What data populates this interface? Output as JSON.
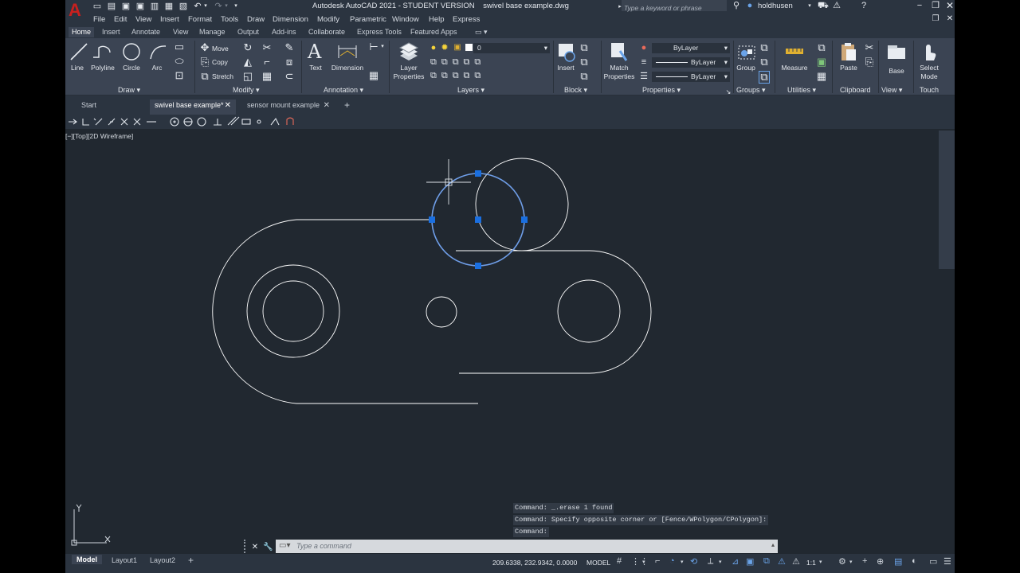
{
  "app": {
    "window_title": "Autodesk AutoCAD 2021 - STUDENT VERSION",
    "file_name": "swivel base example.dwg",
    "search_placeholder": "Type a keyword or phrase",
    "user_name": "holdhusen"
  },
  "menu": [
    "File",
    "Edit",
    "View",
    "Insert",
    "Format",
    "Tools",
    "Draw",
    "Dimension",
    "Modify",
    "Parametric",
    "Window",
    "Help",
    "Express"
  ],
  "ribbon_tabs": [
    "Home",
    "Insert",
    "Annotate",
    "View",
    "Manage",
    "Output",
    "Add-ins",
    "Collaborate",
    "Express Tools",
    "Featured Apps"
  ],
  "ribbon": {
    "draw": {
      "line": "Line",
      "polyline": "Polyline",
      "circle": "Circle",
      "arc": "Arc",
      "title": "Draw"
    },
    "modify": {
      "move": "Move",
      "copy": "Copy",
      "stretch": "Stretch",
      "title": "Modify"
    },
    "annotation": {
      "text": "Text",
      "dimension": "Dimension",
      "title": "Annotation"
    },
    "layers": {
      "layer_properties": "Layer\nProperties",
      "current_layer": "0",
      "title": "Layers"
    },
    "block": {
      "insert": "Insert",
      "title": "Block"
    },
    "properties": {
      "match": "Match\nProperties",
      "color": "ByLayer",
      "linetype": "ByLayer",
      "lineweight": "ByLayer",
      "title": "Properties"
    },
    "groups": {
      "group": "Group",
      "title": "Groups"
    },
    "utilities": {
      "measure": "Measure",
      "title": "Utilities"
    },
    "clipboard": {
      "paste": "Paste",
      "title": "Clipboard"
    },
    "view": {
      "base": "Base",
      "title": "View"
    },
    "touch": {
      "select_mode": "Select\nMode",
      "title": "Touch"
    }
  },
  "doc_tabs": {
    "start": "Start",
    "active": "swivel base example*",
    "other": "sensor mount example"
  },
  "viewport_label": "[−][Top][2D Wireframe]",
  "command_history": [
    "Command:  _.erase 1 found",
    "Command: Specify opposite corner or [Fence/WPolygon/CPolygon]:",
    "Command:"
  ],
  "command_input_placeholder": "Type a command",
  "status": {
    "tabs": [
      "Model",
      "Layout1",
      "Layout2"
    ],
    "coordinates": "209.6338, 232.9342, 0.0000",
    "space": "MODEL",
    "scale": "1:1"
  },
  "ucs": {
    "x": "X",
    "y": "Y"
  },
  "colors": {
    "background": "#212830",
    "ribbon": "#3b4453",
    "geometry": "#ffffff",
    "selection": "#6f9ee8",
    "grip": "#1a6fe0",
    "brand_red": "#c8201e"
  },
  "icons": [
    "autocad-logo-icon",
    "new-icon",
    "open-icon",
    "save-icon",
    "saveas-icon",
    "print-icon",
    "undo-icon",
    "redo-icon",
    "search-icon",
    "user-icon",
    "cart-icon",
    "help-icon",
    "minimize-icon",
    "restore-icon",
    "close-icon"
  ]
}
